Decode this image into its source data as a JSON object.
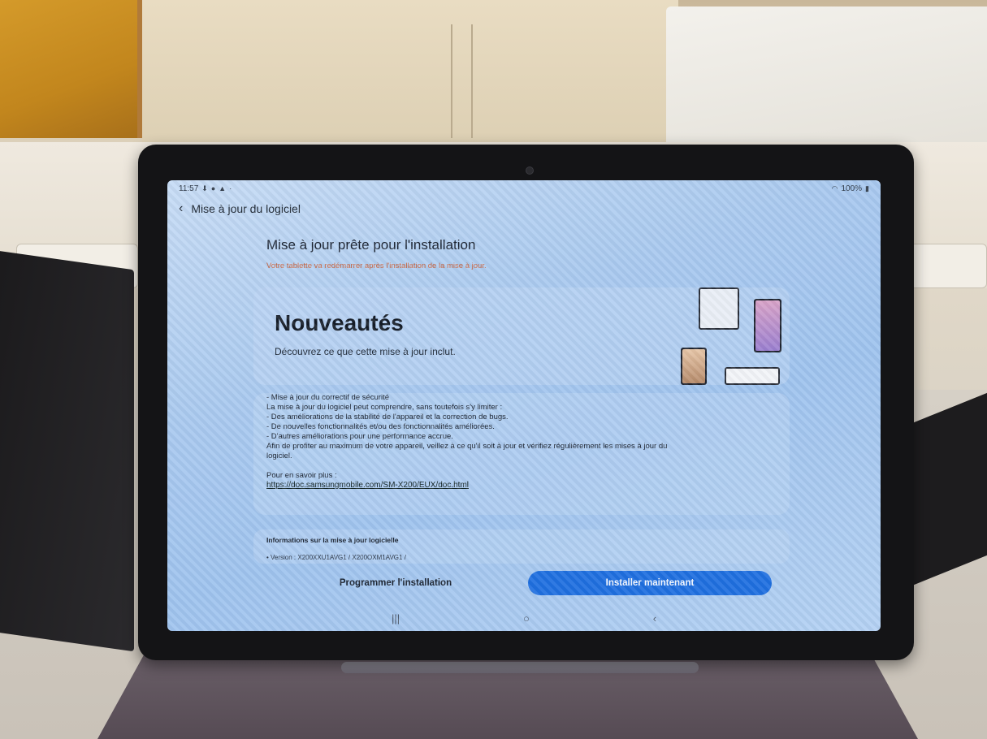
{
  "status_bar": {
    "time": "11:57",
    "left_icons": [
      "download-icon",
      "sync-icon",
      "alert-icon",
      "dot-icon"
    ],
    "battery": "100%"
  },
  "app_bar": {
    "title": "Mise à jour du logiciel"
  },
  "update": {
    "heading": "Mise à jour prête pour l'installation",
    "warning": "Votre tablette va redémarrer après l'installation de la mise à jour."
  },
  "whats_new": {
    "title": "Nouveautés",
    "subtitle": "Découvrez ce que cette mise à jour inclut."
  },
  "details": {
    "lines": [
      "- Mise à jour du correctif de sécurité",
      "La mise à jour du logiciel peut comprendre, sans toutefois s'y limiter :",
      "- Des améliorations de la stabilité de l'appareil et la correction de bugs.",
      "- De nouvelles fonctionnalités et/ou des fonctionnalités améliorées.",
      "- D'autres améliorations pour une performance accrue.",
      "Afin de profiter au maximum de votre appareil, veillez à ce qu'il soit à jour et vérifiez régulièrement les mises à jour du",
      "logiciel."
    ],
    "learn_more_label": "Pour en savoir plus :",
    "learn_more_link": "https://doc.samsungmobile.com/SM-X200/EUX/doc.html"
  },
  "info": {
    "title": "Informations sur la mise à jour logicielle",
    "version": "• Version : X200XXU1AVG1 / X200OXM1AVG1 /"
  },
  "actions": {
    "schedule_label": "Programmer l'installation",
    "install_label": "Installer maintenant"
  },
  "nav": {
    "recents": "|||",
    "home": "○",
    "back": "‹"
  },
  "colors": {
    "accent": "#1f6fe0",
    "warning": "#c9643f"
  }
}
